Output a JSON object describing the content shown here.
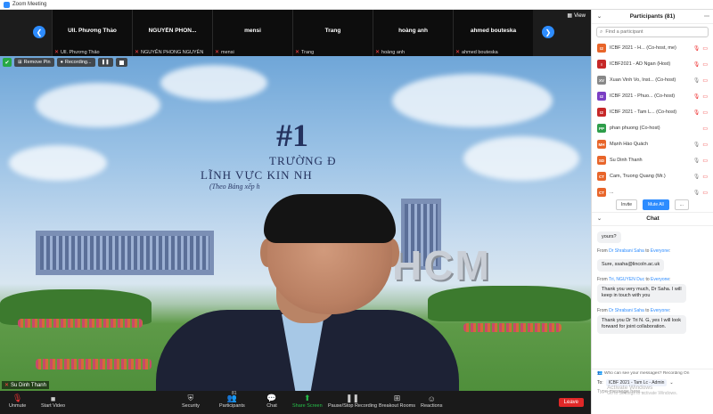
{
  "window": {
    "title": "Zoom Meeting"
  },
  "thumbnails": [
    {
      "name": "Ull. Phương Thảo",
      "label": "Ull. Phương Thảo"
    },
    {
      "name": "NGUYỄN  PHON...",
      "label": "NGUYỄN PHONG NGUYÊN"
    },
    {
      "name": "mensi",
      "label": "mensi"
    },
    {
      "name": "Trang",
      "label": "Trang"
    },
    {
      "name": "hoàng anh",
      "label": "hoàng anh"
    },
    {
      "name": "ahmed bouteska",
      "label": "ahmed bouteska"
    }
  ],
  "view_label": "View",
  "recording": {
    "remove_label": "Remove Pin",
    "recording_label": "Recording..."
  },
  "speaker": {
    "name": "Su Dinh Thanh",
    "banner": {
      "num": "#1",
      "line1": "TRƯỜNG Đ",
      "line2": "LĨNH VỰC KIN          NH",
      "line3": "(Theo Bảng xếp h"
    },
    "sign": "HCM",
    "colors": {
      "sky": "#8fbbe4",
      "grass": "#4f8f3b"
    }
  },
  "toolbar": {
    "unmute": "Unmute",
    "start_video": "Start Video",
    "security": "Security",
    "participants": "Participants",
    "participants_count": "81",
    "chat": "Chat",
    "share_screen": "Share Screen",
    "pause_recording": "Pause/Stop Recording",
    "breakout": "Breakout Rooms",
    "reactions": "Reactions",
    "leave": "Leave"
  },
  "participants_panel": {
    "title": "Participants (81)",
    "search_placeholder": "Find a participant",
    "items": [
      {
        "initials": "I2",
        "color": "#e8652a",
        "name": "ICBF 2021 - H... (Co-host, me)"
      },
      {
        "initials": "I",
        "color": "#c62828",
        "name": "ICBF2021 - AD Ngan (Host)"
      },
      {
        "initials": "XV",
        "color": "#888888",
        "name": "Xuan Vinh Vo, Inst... (Co-host)"
      },
      {
        "initials": "I2",
        "color": "#7b3fc4",
        "name": "ICBF 2021 - Phuo... (Co-host)"
      },
      {
        "initials": "I2",
        "color": "#c62828",
        "name": "ICBF 2021 - Tam L... (Co-host)"
      },
      {
        "initials": "PP",
        "color": "#2e9d4a",
        "name": "phan phuong (Co-host)"
      },
      {
        "initials": "MH",
        "color": "#e8652a",
        "name": "Mạnh Hào Quách"
      },
      {
        "initials": "SD",
        "color": "#e8652a",
        "name": "Su Dinh Thanh"
      },
      {
        "initials": "CT",
        "color": "#e8652a",
        "name": "Cam, Truong Quang (Mr.)"
      },
      {
        "initials": "CT",
        "color": "#e8652a",
        "name": "..."
      }
    ],
    "invite": "Invite",
    "mute_all": "Mute All",
    "more": "..."
  },
  "chat": {
    "title": "Chat",
    "messages": [
      {
        "from": "",
        "to": "",
        "text": "yours?"
      },
      {
        "from": "Dr Shrabani Saha",
        "to": "Everyone",
        "text": "Sure, ssaha@lincoln.ac.uk"
      },
      {
        "from": "Tri, NGUYEN Duc",
        "to": "Everyone",
        "text": "Thank you very much, Dr Saha. I will keep in touch with you"
      },
      {
        "from": "Dr Shrabani Saha",
        "to": "Everyone",
        "text": "Thank you Dr Tri N. G, yes I will look forward for joint collaboration."
      }
    ],
    "from_prefix": "From",
    "to_word": "to",
    "who_can_see": "Who can see your messages? Recording On",
    "to_label": "To:",
    "to_value": "ICBF 2021 - Tam Lc - Admin",
    "type_placeholder": "Type message here...",
    "watermark_title": "Activate Windows",
    "watermark_sub": "Go to Settings to activate Windows."
  }
}
